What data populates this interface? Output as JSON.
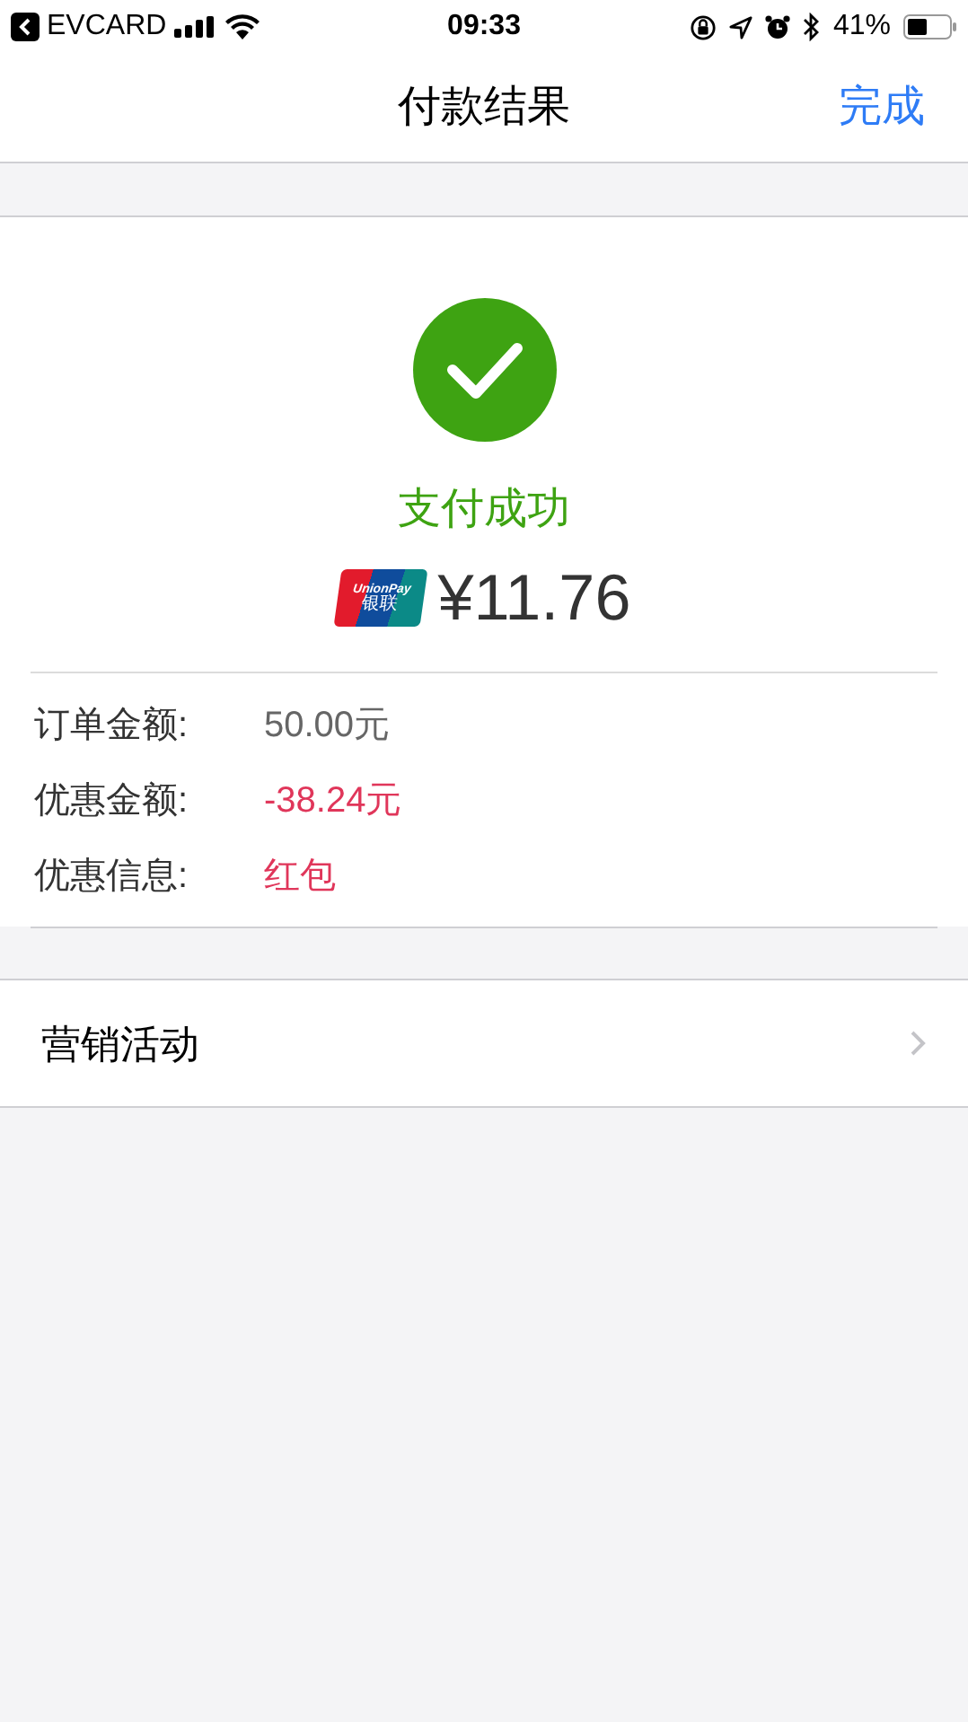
{
  "status_bar": {
    "back_app": "EVCARD",
    "time": "09:33",
    "battery": "41%"
  },
  "nav": {
    "title": "付款结果",
    "done": "完成"
  },
  "result": {
    "status": "支付成功",
    "logo_text": [
      "UnionPay",
      "银联"
    ],
    "amount": "¥11.76"
  },
  "details": [
    {
      "label": "订单金额:",
      "value": "50.00元",
      "kind": "plain"
    },
    {
      "label": "优惠金额:",
      "value": "-38.24元",
      "kind": "discount"
    },
    {
      "label": "优惠信息:",
      "value": "红包",
      "kind": "discount"
    }
  ],
  "menu": [
    {
      "label": "营销活动"
    }
  ]
}
